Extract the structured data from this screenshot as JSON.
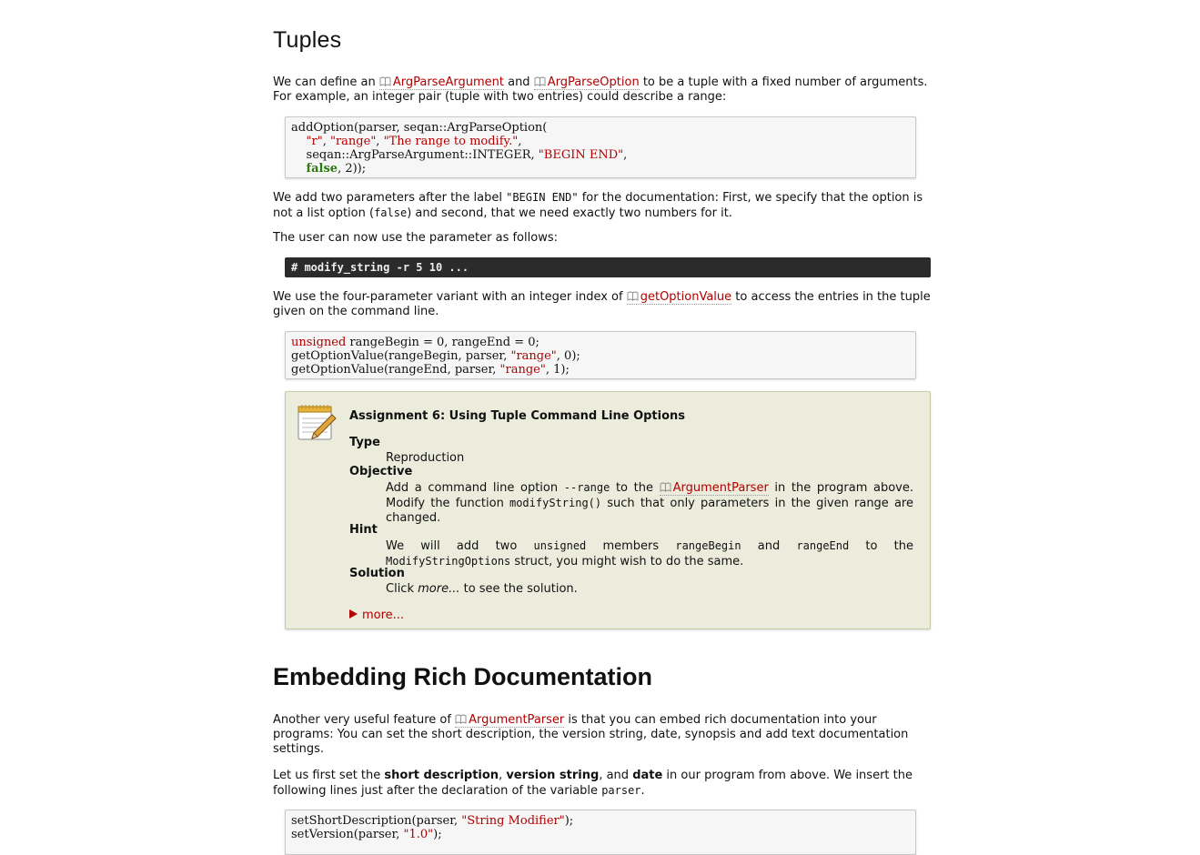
{
  "tuples": {
    "heading": "Tuples",
    "intro_1": "We can define an ",
    "link_arg": "ArgParseArgument",
    "intro_and": " and ",
    "link_opt": "ArgParseOption",
    "intro_2": " to be a tuple with a fixed number of arguments. For example, an integer pair (tuple with two entries) could describe a range:",
    "code1": [
      [
        "addOption(parser, seqan::ArgParseOption("
      ],
      [
        "    ",
        {
          "s": "\"r\""
        },
        ", ",
        {
          "s": "\"range\""
        },
        ", ",
        {
          "s": "\"The range to modify.\""
        },
        ","
      ],
      [
        "    seqan::ArgParseArgument::INTEGER, ",
        {
          "s": "\"BEGIN END\""
        },
        ","
      ],
      [
        "    ",
        {
          "k": "false"
        },
        ", 2));"
      ]
    ],
    "para2_a": "We add two parameters after the label ",
    "para2_code1": "\"BEGIN END\"",
    "para2_b": " for the documentation: First, we specify that the option is not a list option (",
    "para2_code2": "false",
    "para2_c": ") and second, that we need exactly two numbers for it.",
    "para3": "The user can now use the parameter as follows:",
    "console": "# modify_string -r 5 10 ...",
    "para4_a": "We use the four-parameter variant with an integer index of ",
    "link_getopt": "getOptionValue",
    "para4_b": " to access the entries in the tuple given on the command line.",
    "code2": [
      [
        {
          "t": "unsigned"
        },
        " rangeBegin = 0, rangeEnd = 0;"
      ],
      [
        "getOptionValue(rangeBegin, parser, ",
        {
          "s": "\"range\""
        },
        ", 0);"
      ],
      [
        "getOptionValue(rangeEnd, parser, ",
        {
          "s": "\"range\""
        },
        ", 1);"
      ]
    ]
  },
  "assignment": {
    "title": "Assignment 6: Using Tuple Command Line Options",
    "type_label": "Type",
    "type_value": "Reproduction",
    "objective_label": "Objective",
    "objective_a": "Add a command line option ",
    "objective_code1": "--range",
    "objective_b": " to the ",
    "objective_link": "ArgumentParser",
    "objective_c": " in the program above. Modify the function ",
    "objective_code2": "modifyString()",
    "objective_d": " such that only parameters in the given range are changed.",
    "hint_label": "Hint",
    "hint_a": "We will add two ",
    "hint_code1": "unsigned",
    "hint_b": " members ",
    "hint_code2": "rangeBegin",
    "hint_c": " and ",
    "hint_code3": "rangeEnd",
    "hint_d": " to the ",
    "hint_code4": "ModifyStringOptions",
    "hint_e": " struct, you might wish to do the same.",
    "solution_label": "Solution",
    "solution_a": "Click ",
    "solution_em": "more...",
    "solution_b": " to see the solution.",
    "more_link": "more..."
  },
  "rich": {
    "heading": "Embedding Rich Documentation",
    "p1_a": "Another very useful feature of ",
    "p1_link": "ArgumentParser",
    "p1_b": " is that you can embed rich documentation into your programs: You can set the short description, the version string, date, synopsis and add text documentation settings.",
    "p2_a": "Let us first set the ",
    "p2_b1": "short description",
    "p2_c": ", ",
    "p2_b2": "version string",
    "p2_d": ", and ",
    "p2_b3": "date",
    "p2_e": " in our program from above. We insert the following lines just after the declaration of the variable ",
    "p2_code": "parser",
    "p2_f": ".",
    "code3": [
      [
        "setShortDescription(parser, ",
        {
          "s": "\"String Modifier\""
        },
        ");"
      ],
      [
        "setVersion(parser, ",
        {
          "s": "\"1.0\""
        },
        ");"
      ]
    ]
  }
}
